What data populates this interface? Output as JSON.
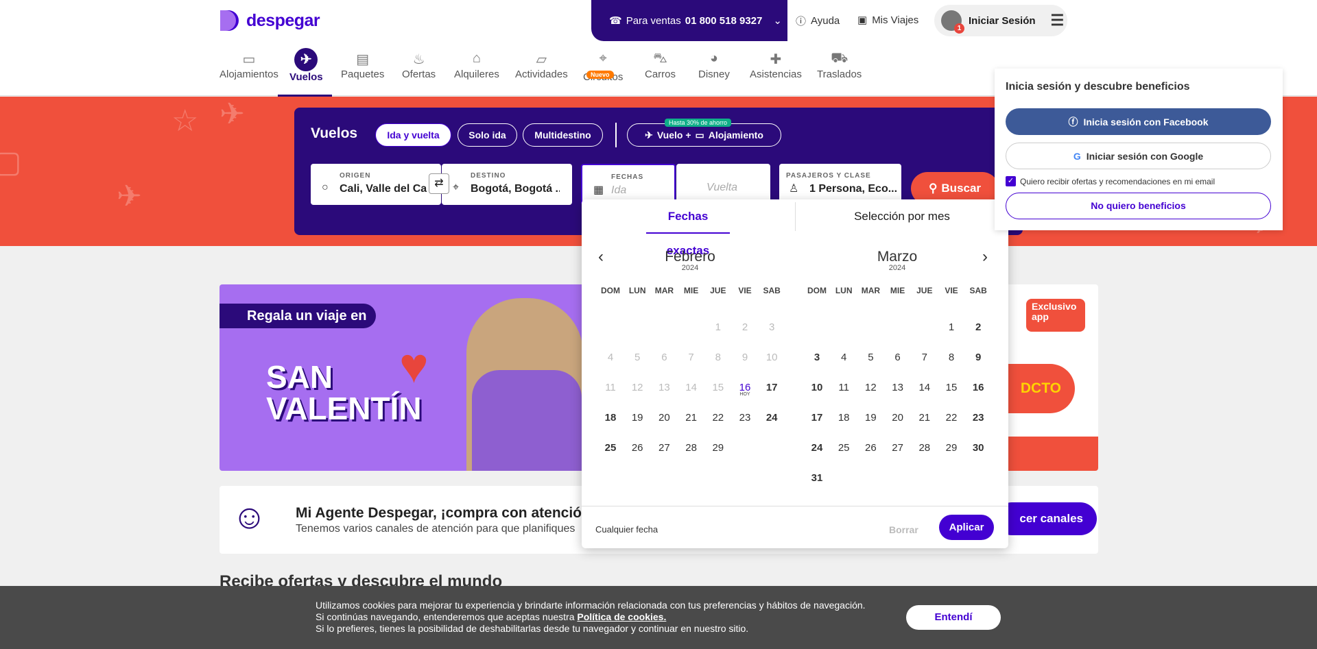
{
  "header": {
    "logo": "despegar",
    "sales_prefix": "Para ventas",
    "sales_phone": "01 800 518 9327",
    "help": "Ayuda",
    "trips": "Mis Viajes",
    "login": "Iniciar Sesión",
    "notif_count": "1"
  },
  "nav": [
    {
      "label": "Alojamientos",
      "icon": "bed-icon"
    },
    {
      "label": "Vuelos",
      "icon": "plane-icon"
    },
    {
      "label": "Paquetes",
      "icon": "suitcase-icon"
    },
    {
      "label": "Ofertas",
      "icon": "fire-icon"
    },
    {
      "label": "Alquileres",
      "icon": "house-icon"
    },
    {
      "label": "Actividades",
      "icon": "ticket-icon"
    },
    {
      "label": "Circuitos",
      "icon": "map-pin-icon",
      "badge": "Nuevo"
    },
    {
      "label": "Carros",
      "icon": "car-icon"
    },
    {
      "label": "Disney",
      "icon": "mickey-icon"
    },
    {
      "label": "Asistencias",
      "icon": "medkit-icon"
    },
    {
      "label": "Traslados",
      "icon": "van-icon"
    }
  ],
  "search": {
    "title": "Vuelos",
    "trip_types": [
      "Ida y vuelta",
      "Solo ida",
      "Multidestino"
    ],
    "combo_badge": "Hasta 30% de ahorro",
    "combo_vuelo": "Vuelo +",
    "combo_aloj": "Alojamiento",
    "origin_label": "ORIGEN",
    "origin_value": "Cali, Valle del Ca ...",
    "dest_label": "DESTINO",
    "dest_value": "Bogotá, Bogotá ...",
    "dates_label": "FECHAS",
    "ida_placeholder": "Ida",
    "vuelta_placeholder": "Vuelta",
    "pax_label": "PASAJEROS Y CLASE",
    "pax_value": "1 Persona, Eco...",
    "search_btn": "Buscar"
  },
  "calendar": {
    "tab_exact": "Fechas exactas",
    "tab_month": "Selección por mes",
    "dows": [
      "DOM",
      "LUN",
      "MAR",
      "MIE",
      "JUE",
      "VIE",
      "SAB"
    ],
    "left": {
      "name": "Febrero",
      "year": "2024"
    },
    "right": {
      "name": "Marzo",
      "year": "2024"
    },
    "today_label": "HOY",
    "any_date": "Cualquier fecha",
    "clear": "Borrar",
    "apply": "Aplicar"
  },
  "banner": {
    "ribbon": "Regala un viaje en",
    "line1": "SAN",
    "line2": "VALENTÍN",
    "side_tag": "Exclusivo app",
    "side_dcto": "DCTO"
  },
  "agent": {
    "title": "Mi Agente Despegar, ¡compra con atención p",
    "subtitle": "Tenemos varios canales de atención para que planifiques",
    "button": "cer canales"
  },
  "recibe": "Recibe ofertas y descubre el mundo",
  "login_panel": {
    "title": "Inicia sesión y descubre beneficios",
    "facebook": "Inicia sesión con Facebook",
    "google": "Iniciar sesión con Google",
    "checkbox": "Quiero recibir ofertas y recomendaciones en mi email",
    "no_thanks": "No quiero beneficios"
  },
  "cookies": {
    "line1": "Utilizamos cookies para mejorar tu experiencia y brindarte información relacionada con tus preferencias y hábitos de navegación.",
    "line2_prefix": "Si continúas navegando, entenderemos que aceptas nuestra",
    "line2_link": "Política de cookies.",
    "line3": "Si lo prefieres, tienes la posibilidad de deshabilitarlas desde tu navegador y continuar en nuestro sitio.",
    "accept": "Entendí"
  },
  "colors": {
    "brand": "#4300d2",
    "dark": "#2b0a7a",
    "hero": "#f0503c"
  }
}
